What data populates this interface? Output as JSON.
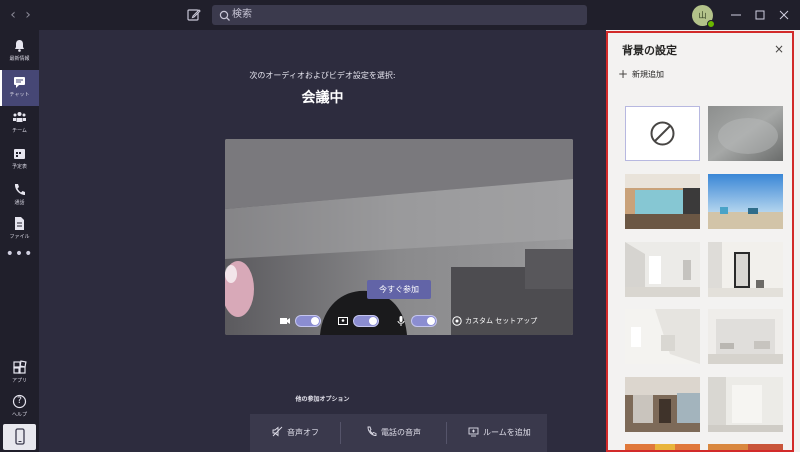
{
  "titlebar": {
    "back_icon": "chevron-left-icon",
    "forward_icon": "chevron-right-icon",
    "compose_icon": "compose-icon",
    "search_placeholder": "検索",
    "avatar_initials": "山",
    "status": "available"
  },
  "rail": {
    "items": [
      {
        "label": "最新情報",
        "icon": "bell-icon"
      },
      {
        "label": "チャット",
        "icon": "chat-icon"
      },
      {
        "label": "チーム",
        "icon": "teams-icon"
      },
      {
        "label": "予定表",
        "icon": "calendar-icon"
      },
      {
        "label": "通話",
        "icon": "phone-icon"
      },
      {
        "label": "ファイル",
        "icon": "file-icon"
      }
    ],
    "more": "•••",
    "apps_label": "アプリ",
    "help_label": "ヘルプ",
    "help_glyph": "?"
  },
  "main": {
    "subtitle": "次のオーディオおよびビデオ設定を選択:",
    "title": "会議中",
    "join_button": "今すぐ参加",
    "custom_setup": "カスタム セットアップ",
    "video_on": true,
    "blur_on": true,
    "mic_on": true,
    "other_options_title": "他の参加オプション",
    "options": {
      "audio_off": "音声オフ",
      "phone_audio": "電話の音声",
      "add_room": "ルームを追加"
    }
  },
  "panel": {
    "title": "背景の設定",
    "close": "×",
    "add_new": "新規追加",
    "thumbnails": [
      {
        "kind": "none"
      },
      {
        "kind": "blur"
      },
      {
        "kind": "office"
      },
      {
        "kind": "beach"
      },
      {
        "kind": "white-room"
      },
      {
        "kind": "white-room-mirror"
      },
      {
        "kind": "bright-room"
      },
      {
        "kind": "white-studio"
      },
      {
        "kind": "loft"
      },
      {
        "kind": "plain-room"
      }
    ]
  },
  "colors": {
    "accent": "#6264a7",
    "rail_bg": "#201f2b",
    "main_bg": "#2d2c3e",
    "highlight_border": "#d22a2a"
  }
}
